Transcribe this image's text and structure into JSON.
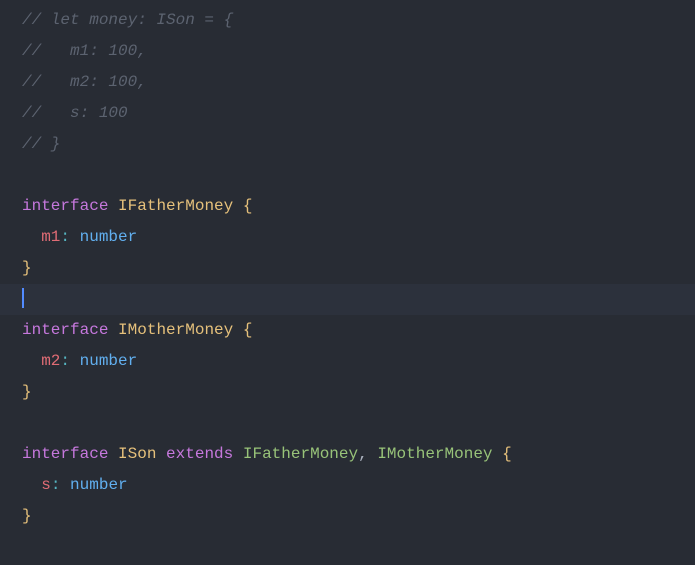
{
  "code": {
    "line1_comment": "// let money: ISon = {",
    "line2_comment": "//   m1: 100,",
    "line3_comment": "//   m2: 100,",
    "line4_comment": "//   s: 100",
    "line5_comment": "// }",
    "kw_interface": "interface",
    "kw_extends": "extends",
    "name_IFatherMoney": "IFatherMoney",
    "name_IMotherMoney": "IMotherMoney",
    "name_ISon": "ISon",
    "prop_m1": "m1",
    "prop_m2": "m2",
    "prop_s": "s",
    "type_number": "number",
    "brace_open": "{",
    "brace_close": "}",
    "colon": ":",
    "comma": ",",
    "space": " ",
    "indent": "  "
  }
}
